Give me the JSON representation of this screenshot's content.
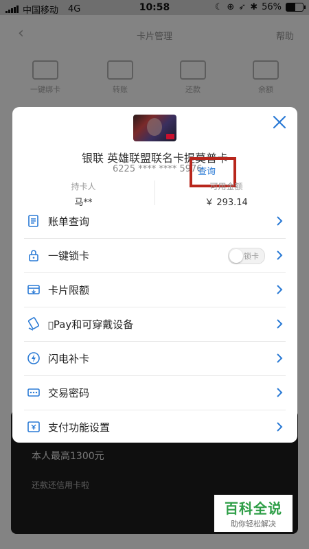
{
  "status_bar": {
    "carrier": "中国移动",
    "network": "4G",
    "time": "10:58",
    "battery": "56%"
  },
  "background": {
    "title": "卡片管理",
    "help": "帮助",
    "icons": [
      "一键绑卡",
      "转账",
      "还款",
      "余额"
    ],
    "card_text_1": "本人最高1300元",
    "card_text_2": "还款还信用卡啦"
  },
  "modal": {
    "card_name": "银联 英雄联盟联名卡提莫普卡",
    "card_number": "6225 **** **** 5976",
    "query_label": "查询",
    "holder_label": "持卡人",
    "holder_value": "马**",
    "available_label": "可用金额",
    "available_value": "￥ 293.14",
    "menu": [
      {
        "label": "账单查询",
        "icon": "bill-icon"
      },
      {
        "label": "一键锁卡",
        "icon": "lock-icon",
        "toggle_label": "锁卡",
        "toggle_on": false
      },
      {
        "label": "卡片限额",
        "icon": "card-limit-icon"
      },
      {
        "label": "Pay和可穿戴设备",
        "icon": "apple-pay-icon"
      },
      {
        "label": "闪电补卡",
        "icon": "lightning-card-icon"
      },
      {
        "label": "交易密码",
        "icon": "password-icon"
      },
      {
        "label": "支付功能设置",
        "icon": "payment-settings-icon"
      }
    ]
  },
  "watermark": {
    "title": "百科全说",
    "subtitle": "助你轻松解决"
  },
  "colors": {
    "accent": "#2a7ad5",
    "highlight_box": "#b8261c",
    "watermark": "#2e9e47"
  }
}
